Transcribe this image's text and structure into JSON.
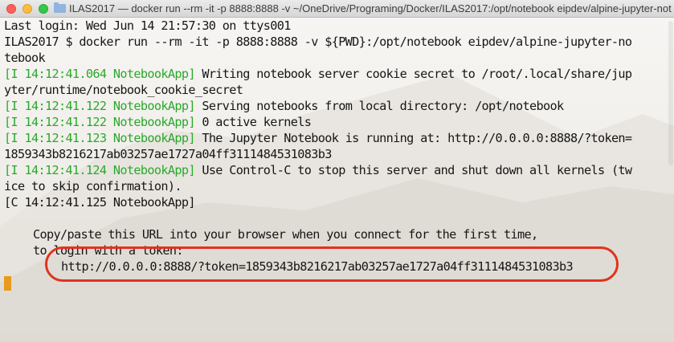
{
  "window": {
    "title": "ILAS2017 — docker run --rm -it -p 8888:8888 -v ~/OneDrive/Programing/Docker/ILAS2017:/opt/notebook eipdev/alpine-jupyter-notebook"
  },
  "terminal": {
    "last_login": "Last login: Wed Jun 14 21:57:30 on ttys001",
    "prompt_line1": "ILAS2017 $ docker run --rm -it -p 8888:8888 -v ${PWD}:/opt/notebook eipdev/alpine-jupyter-no",
    "prompt_line2": "tebook",
    "log": [
      {
        "prefix": "[I 14:12:41.064 NotebookApp]",
        "text": " Writing notebook server cookie secret to /root/.local/share/jup"
      },
      {
        "prefix": "",
        "text": "yter/runtime/notebook_cookie_secret"
      },
      {
        "prefix": "[I 14:12:41.122 NotebookApp]",
        "text": " Serving notebooks from local directory: /opt/notebook"
      },
      {
        "prefix": "[I 14:12:41.122 NotebookApp]",
        "text": " 0 active kernels"
      },
      {
        "prefix": "[I 14:12:41.123 NotebookApp]",
        "text": " The Jupyter Notebook is running at: http://0.0.0.0:8888/?token="
      },
      {
        "prefix": "",
        "text": "1859343b8216217ab03257ae1727a04ff3111484531083b3"
      },
      {
        "prefix": "[I 14:12:41.124 NotebookApp]",
        "text": " Use Control-C to stop this server and shut down all kernels (tw"
      },
      {
        "prefix": "",
        "text": "ice to skip confirmation)."
      }
    ],
    "critical_line": "[C 14:12:41.125 NotebookApp]",
    "copy_paste_line1": "Copy/paste this URL into your browser when you connect for the first time,",
    "copy_paste_line2": "to login with a token:",
    "token_url": "http://0.0.0.0:8888/?token=1859343b8216217ab03257ae1727a04ff3111484531083b3"
  },
  "colors": {
    "log_prefix": "#2aa92a",
    "highlight_oval": "#e2321e",
    "cursor": "#e79a1b"
  }
}
